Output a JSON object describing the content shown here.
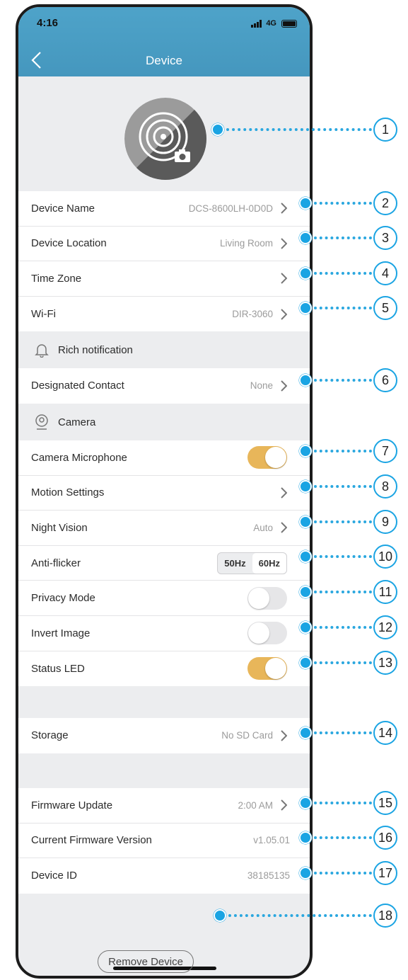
{
  "status_bar": {
    "time": "4:16",
    "network": "4G"
  },
  "header": {
    "title": "Device"
  },
  "settings": [
    {
      "label": "Device Name",
      "value": "DCS-8600LH-0D0D"
    },
    {
      "label": "Device Location",
      "value": "Living Room"
    },
    {
      "label": "Time Zone",
      "value": ""
    },
    {
      "label": "Wi-Fi",
      "value": "DIR-3060"
    }
  ],
  "sections": {
    "rich_notification": "Rich notification",
    "camera": "Camera"
  },
  "notification_rows": [
    {
      "label": "Designated Contact",
      "value": "None"
    }
  ],
  "camera_rows": [
    {
      "label": "Camera Microphone",
      "toggle": true
    },
    {
      "label": "Motion Settings",
      "value": ""
    },
    {
      "label": "Night Vision",
      "value": "Auto"
    },
    {
      "label": "Anti-flicker",
      "options": [
        "50Hz",
        "60Hz"
      ],
      "selected": "60Hz"
    },
    {
      "label": "Privacy Mode",
      "toggle": false
    },
    {
      "label": "Invert Image",
      "toggle": false
    },
    {
      "label": "Status LED",
      "toggle": true
    }
  ],
  "storage": {
    "label": "Storage",
    "value": "No SD Card"
  },
  "firmware_rows": [
    {
      "label": "Firmware Update",
      "value": "2:00 AM"
    },
    {
      "label": "Current Firmware Version",
      "value": "v1.05.01"
    },
    {
      "label": "Device ID",
      "value": "38185135"
    }
  ],
  "remove_button": "Remove Device",
  "callouts": [
    "1",
    "2",
    "3",
    "4",
    "5",
    "6",
    "7",
    "8",
    "9",
    "10",
    "11",
    "12",
    "13",
    "14",
    "15",
    "16",
    "17",
    "18"
  ],
  "colors": {
    "header": "#4597be",
    "toggle_on": "#e8b65a",
    "callout": "#1aa4e3"
  }
}
